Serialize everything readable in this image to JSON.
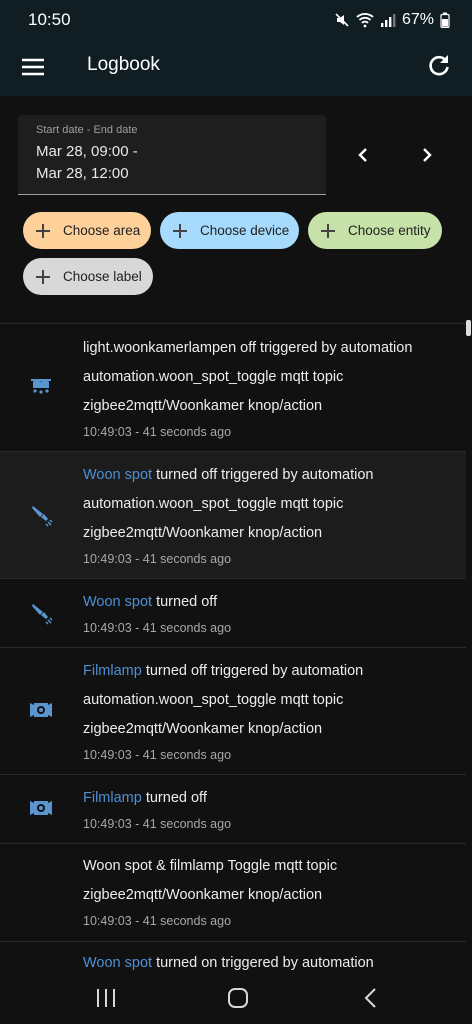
{
  "status_bar": {
    "time": "10:50",
    "battery": "67%"
  },
  "app_bar": {
    "title": "Logbook"
  },
  "date_range": {
    "label": "Start date - End date",
    "start": "Mar 28, 09:00 -",
    "end": "Mar 28, 12:00"
  },
  "filters": {
    "area": "Choose area",
    "device": "Choose device",
    "entity": "Choose entity",
    "label": "Choose label"
  },
  "colors": {
    "accent": "#4f8fd4",
    "area_chip": "#fed09a",
    "device_chip": "#a6dbfd",
    "entity_chip": "#c6e2a9",
    "label_chip": "#d8d8d8"
  },
  "entries": [
    {
      "icon": "ceiling-lights-icon",
      "entity": "",
      "lines": [
        "light.woonkamerlampen off triggered by automation",
        "automation.woon_spot_toggle mqtt topic",
        "zigbee2mqtt/Woonkamer knop/action"
      ],
      "time": "10:49:03 - 41 seconds ago"
    },
    {
      "icon": "spotlight-icon",
      "entity": "Woon spot",
      "lines": [
        " turned off triggered by automation",
        "automation.woon_spot_toggle mqtt topic",
        "zigbee2mqtt/Woonkamer knop/action"
      ],
      "time": "10:49:03 - 41 seconds ago"
    },
    {
      "icon": "spotlight-icon",
      "entity": "Woon spot",
      "lines": [
        " turned off"
      ],
      "time": "10:49:03 - 41 seconds ago"
    },
    {
      "icon": "film-light-icon",
      "entity": "Filmlamp",
      "lines": [
        " turned off triggered by automation",
        "automation.woon_spot_toggle mqtt topic",
        "zigbee2mqtt/Woonkamer knop/action"
      ],
      "time": "10:49:03 - 41 seconds ago"
    },
    {
      "icon": "film-light-icon",
      "entity": "Filmlamp",
      "lines": [
        " turned off"
      ],
      "time": "10:49:03 - 41 seconds ago"
    },
    {
      "icon": "",
      "entity": "",
      "lines": [
        "Woon spot & filmlamp Toggle mqtt topic",
        "zigbee2mqtt/Woonkamer knop/action"
      ],
      "time": "10:49:03 - 41 seconds ago"
    },
    {
      "icon": "",
      "entity": "Woon spot",
      "lines": [
        " turned on triggered by automation"
      ],
      "time": ""
    }
  ]
}
